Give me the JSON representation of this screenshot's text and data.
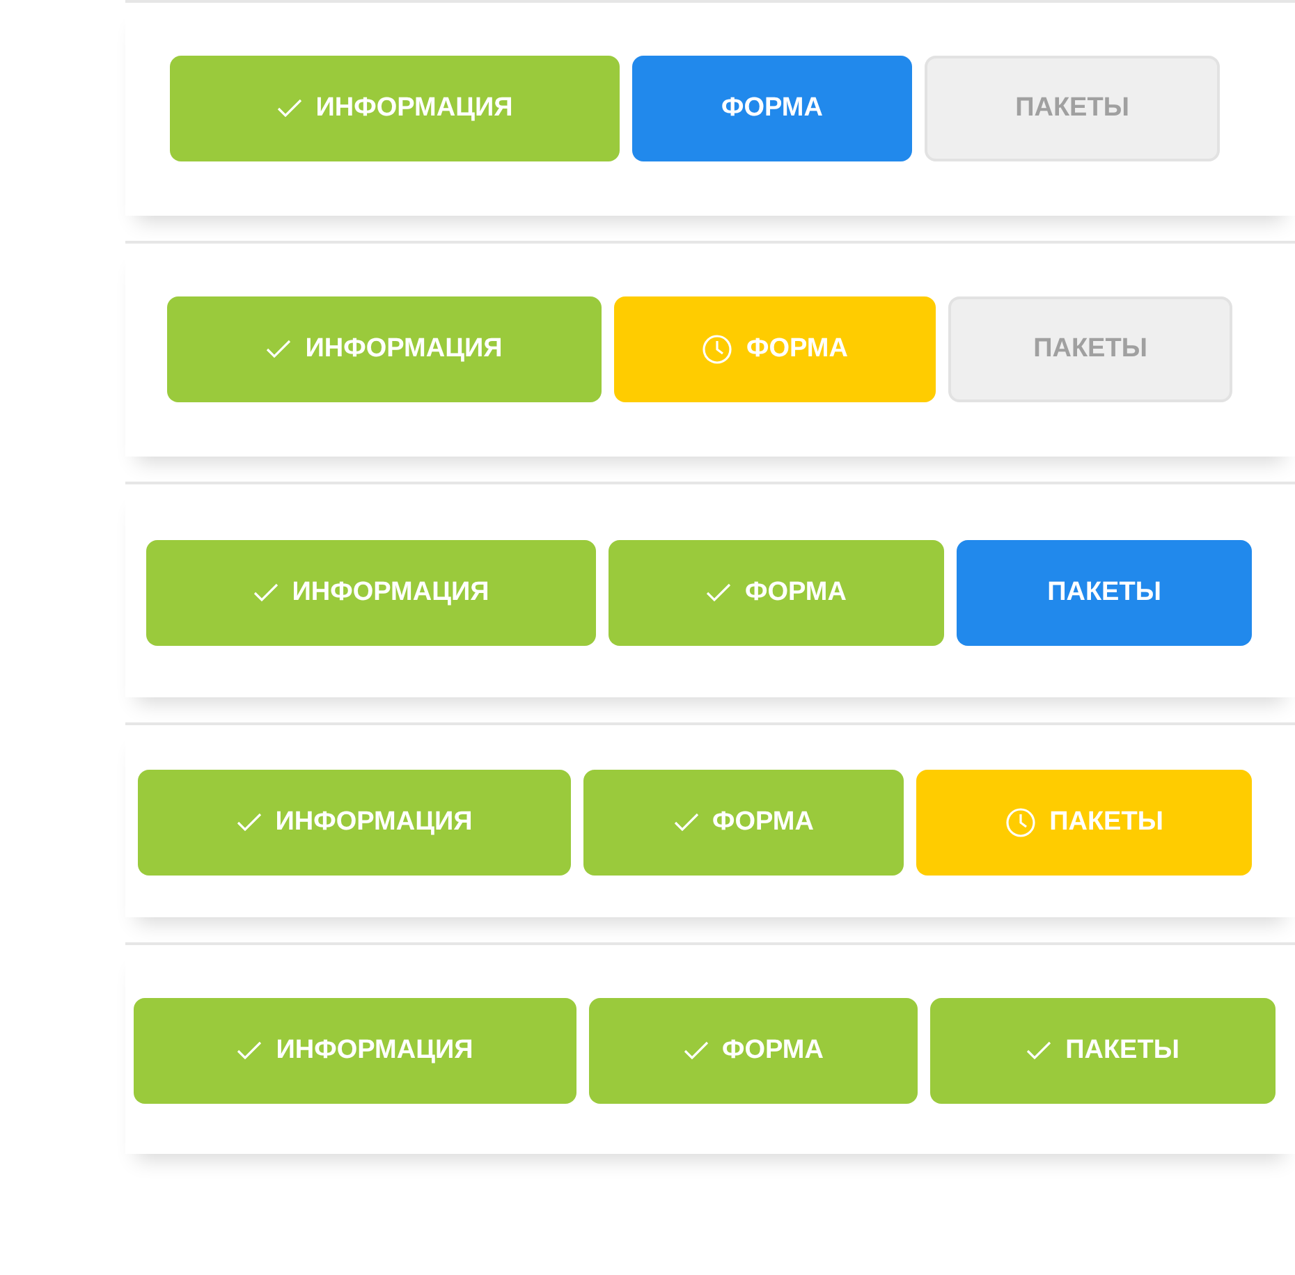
{
  "step_bars": [
    {
      "steps": [
        {
          "label": "ИНФОРМАЦИЯ",
          "kind": "done"
        },
        {
          "label": "ФОРМА",
          "kind": "active"
        },
        {
          "label": "ПАКЕТЫ",
          "kind": "pending"
        }
      ]
    },
    {
      "steps": [
        {
          "label": "ИНФОРМАЦИЯ",
          "kind": "done"
        },
        {
          "label": "ФОРМА",
          "kind": "waiting"
        },
        {
          "label": "ПАКЕТЫ",
          "kind": "pending"
        }
      ]
    },
    {
      "steps": [
        {
          "label": "ИНФОРМАЦИЯ",
          "kind": "done"
        },
        {
          "label": "ФОРМА",
          "kind": "done"
        },
        {
          "label": "ПАКЕТЫ",
          "kind": "active"
        }
      ]
    },
    {
      "steps": [
        {
          "label": "ИНФОРМАЦИЯ",
          "kind": "done"
        },
        {
          "label": "ФОРМА",
          "kind": "done"
        },
        {
          "label": "ПАКЕТЫ",
          "kind": "waiting"
        }
      ]
    },
    {
      "steps": [
        {
          "label": "ИНФОРМАЦИЯ",
          "kind": "done"
        },
        {
          "label": "ФОРМА",
          "kind": "done"
        },
        {
          "label": "ПАКЕТЫ",
          "kind": "done"
        }
      ]
    }
  ]
}
